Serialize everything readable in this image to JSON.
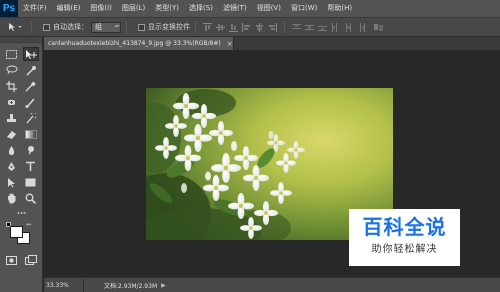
{
  "app": {
    "logo": "Ps"
  },
  "menu": [
    "文件(F)",
    "编辑(E)",
    "图像(I)",
    "图层(L)",
    "类型(Y)",
    "选择(S)",
    "滤镜(T)",
    "视图(V)",
    "窗口(W)",
    "帮助(H)"
  ],
  "options": {
    "auto_select_label": "自动选择：",
    "auto_select_value": "组",
    "show_transform_label": "显示变换控件"
  },
  "document": {
    "tab_title": "canlanhuaduotexiebizhi_413874_9.jpg @ 33.3%(RGB/8#)",
    "close_glyph": "×"
  },
  "status": {
    "zoom": "33.33%",
    "doc_size": "文档:2.93M/2.93M",
    "arrow": "▶"
  },
  "colors": {
    "foreground": "#ffffff",
    "background": "#ffffff",
    "accent": "#31a8ff",
    "watermark_blue": "#1b72e8"
  },
  "watermark": {
    "title": "百科全说",
    "subtitle": "助你轻松解决"
  },
  "icons": {
    "tools": [
      "move-tool-icon",
      "marquee-tool-icon",
      "lasso-tool-icon",
      "quick-select-tool-icon",
      "crop-tool-icon",
      "eyedropper-tool-icon",
      "healing-brush-icon",
      "brush-tool-icon",
      "clone-stamp-icon",
      "history-brush-icon",
      "eraser-tool-icon",
      "gradient-tool-icon",
      "blur-tool-icon",
      "dodge-tool-icon",
      "pen-tool-icon",
      "type-tool-icon",
      "path-select-tool-icon",
      "rectangle-tool-icon",
      "hand-tool-icon",
      "zoom-tool-icon",
      "color-swatches-icon",
      "quick-mask-icon",
      "screen-mode-icon"
    ]
  }
}
